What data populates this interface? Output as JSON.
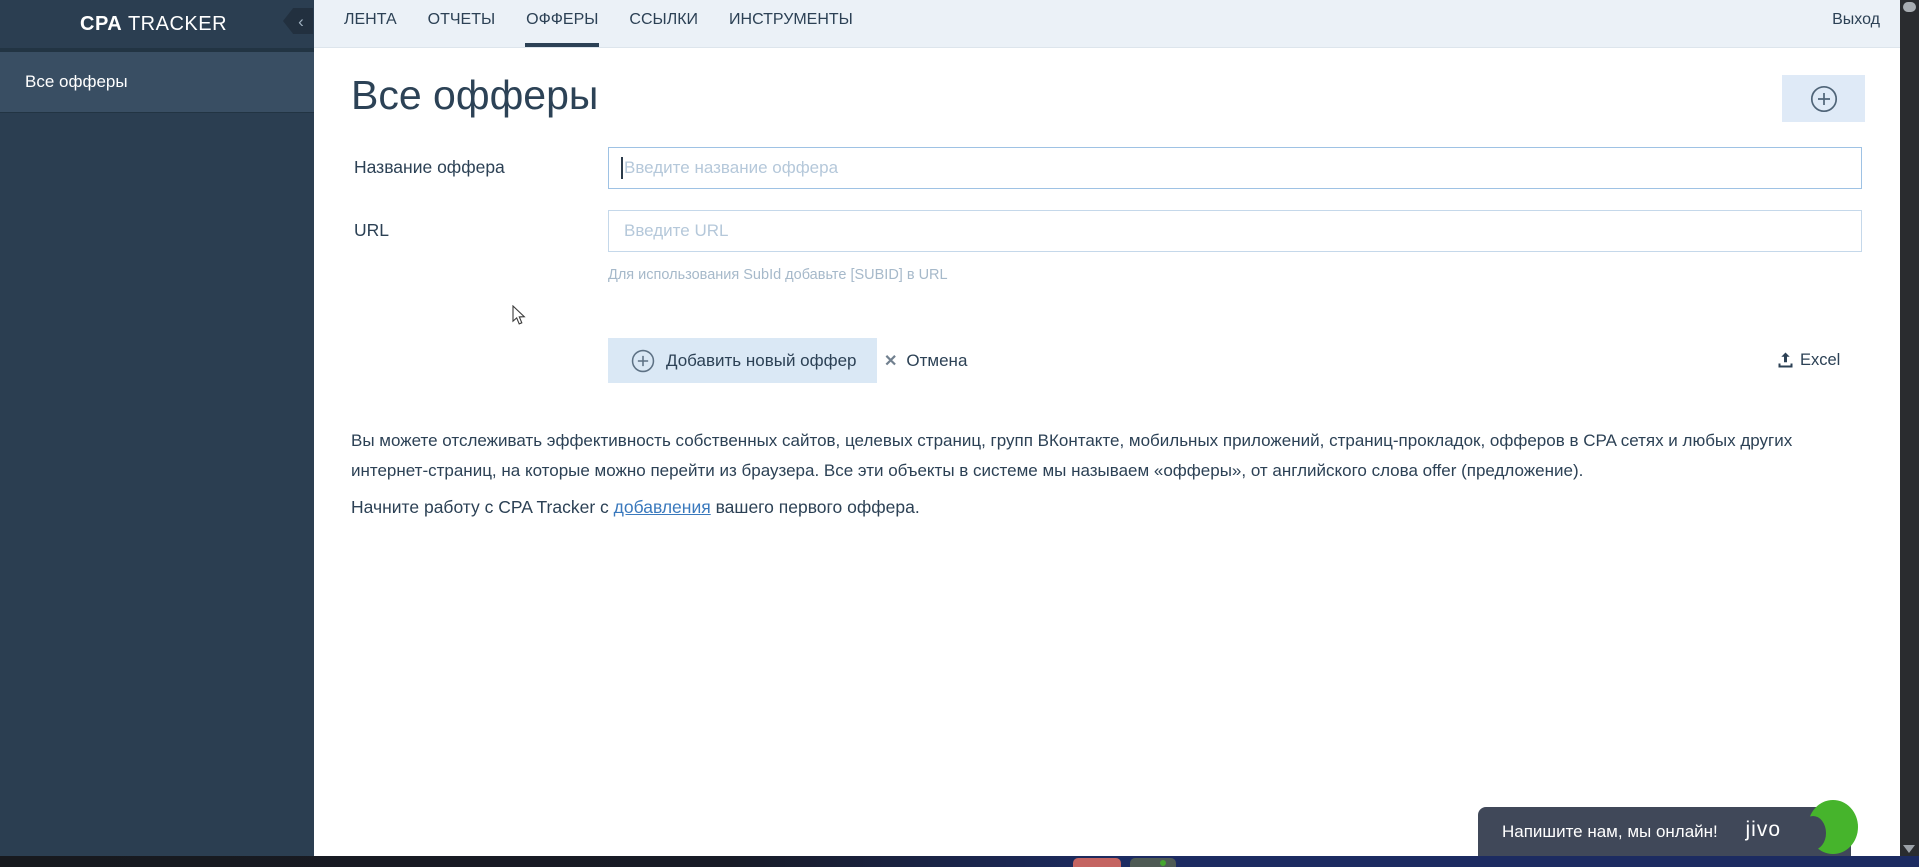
{
  "app": {
    "brand_bold": "CPA",
    "brand_rest": " TRACKER",
    "collapse_icon": "‹"
  },
  "sidebar": {
    "items": [
      {
        "label": "Все офферы",
        "active": true
      }
    ]
  },
  "nav": {
    "tabs": [
      {
        "label": "ЛЕНТА",
        "active": false
      },
      {
        "label": "ОТЧЕТЫ",
        "active": false
      },
      {
        "label": "ОФФЕРЫ",
        "active": true
      },
      {
        "label": "ССЫЛКИ",
        "active": false
      },
      {
        "label": "ИНСТРУМЕНТЫ",
        "active": false
      }
    ],
    "logout_label": "Выход"
  },
  "page": {
    "title": "Все офферы"
  },
  "form": {
    "name_label": "Название оффера",
    "name_placeholder": "Введите название оффера",
    "name_value": "",
    "url_label": "URL",
    "url_placeholder": "Введите URL",
    "url_value": "",
    "url_hint": "Для использования SubId добавьте [SUBID] в URL",
    "submit_label": "Добавить новый оффер",
    "cancel_label": "Отмена",
    "cancel_icon": "✕",
    "excel_label": "Excel"
  },
  "description": {
    "paragraph": "Вы можете отслеживать эффективность собственных сайтов, целевых страниц, групп ВКонтакте, мобильных приложений, страниц-прокладок, офферов в CPA сетях и любых других интернет-страниц, на которые можно перейти из браузера. Все эти объекты в системе мы называем «офферы», от английского слова offer (предложение).",
    "start_before": "Начните работу с CPA Tracker с ",
    "start_link": "добавления",
    "start_after": " вашего первого оффера."
  },
  "chat": {
    "message": "Напишите нам, мы онлайн!",
    "brand": "jivo"
  },
  "colors": {
    "sidebar_bg": "#2b3e51",
    "sidebar_active_bg": "#394e63",
    "nav_bg": "#ebf1f7",
    "text_navy": "#2c4155",
    "button_bg": "#dae8f5",
    "link_blue": "#3a79bd",
    "placeholder": "#b5c8da",
    "hint_gray": "#a6b9ca",
    "jivo_bg": "#404859",
    "jivo_green": "#46b42c"
  }
}
